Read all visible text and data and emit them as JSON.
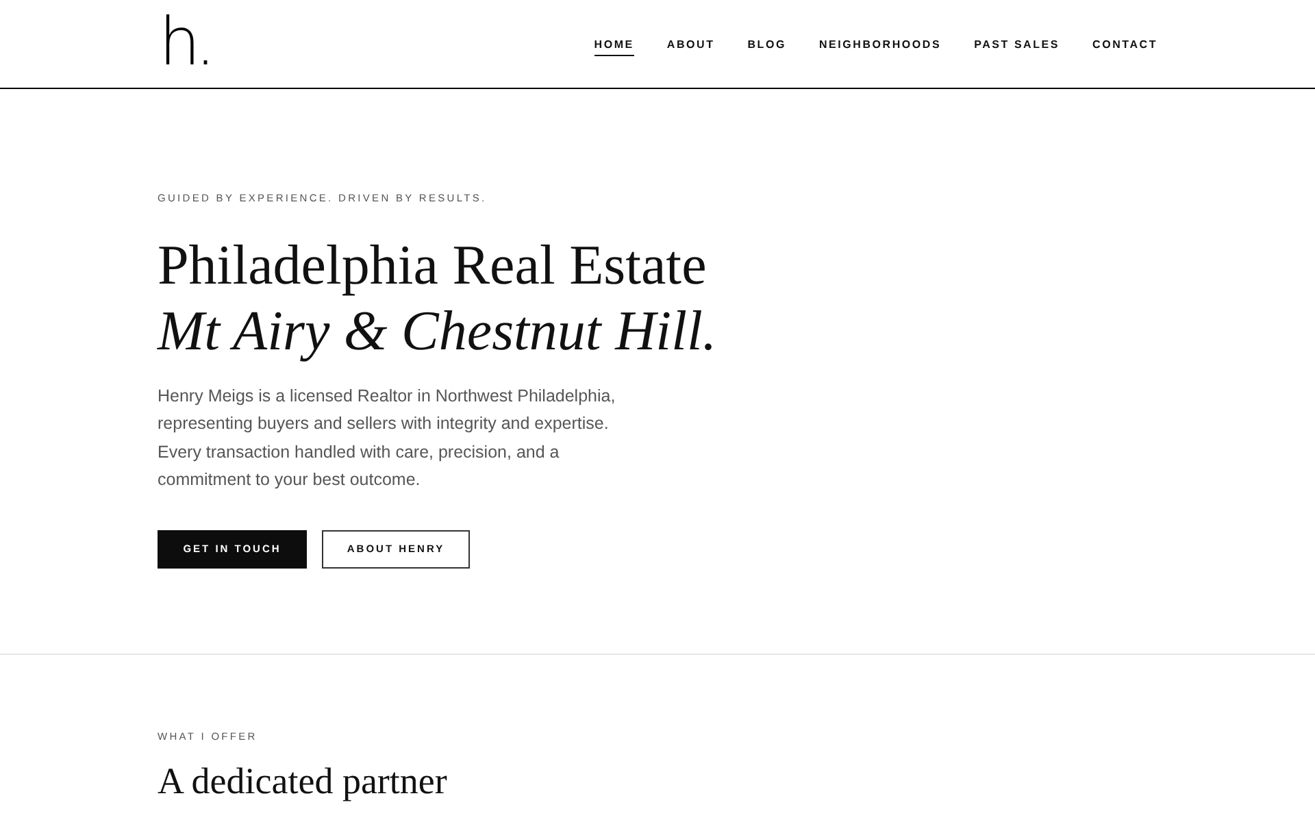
{
  "header": {
    "logo": "h.",
    "nav": [
      {
        "label": "HOME",
        "selected": true
      },
      {
        "label": "ABOUT",
        "selected": false
      },
      {
        "label": "BLOG",
        "selected": false
      },
      {
        "label": "NEIGHBORHOODS",
        "selected": false
      },
      {
        "label": "PAST SALES",
        "selected": false
      },
      {
        "label": "CONTACT",
        "selected": false
      }
    ]
  },
  "hero": {
    "eyebrow": "GUIDED BY EXPERIENCE. DRIVEN BY RESULTS.",
    "title": "Philadelphia Real Estate",
    "subtitle": "Mt Airy & Chestnut Hill.",
    "body": "Henry Meigs is a licensed Realtor in Northwest Philadelphia, representing buyers and sellers with integrity and expertise. Every transaction handled with care, precision, and a commitment to your best outcome.",
    "buttons": [
      {
        "label": "GET IN TOUCH",
        "kind": "primary"
      },
      {
        "label": "ABOUT HENRY",
        "kind": "secondary"
      }
    ]
  },
  "offer": {
    "eyebrow": "WHAT I OFFER",
    "title": "A dedicated partner"
  }
}
